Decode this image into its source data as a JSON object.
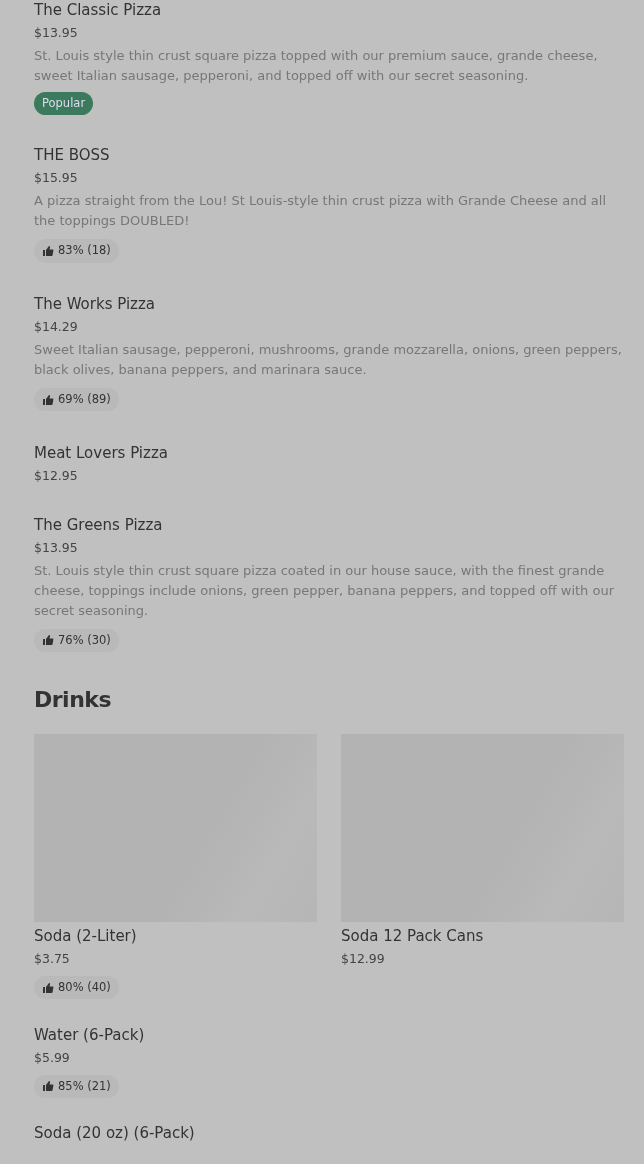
{
  "pizza_items": [
    {
      "name": "The Classic Pizza",
      "price": "$13.95",
      "description": "St. Louis style thin crust square pizza topped with our premium sauce, grande cheese, sweet Italian sausage, pepperoni, and topped off with our secret seasoning.",
      "badge": "Popular"
    },
    {
      "name": "THE BOSS",
      "price": "$15.95",
      "description": "A pizza straight from the Lou! St Louis-style thin crust pizza with Grande Cheese and all the toppings DOUBLED!",
      "rating": "83% (18)"
    },
    {
      "name": "The Works Pizza",
      "price": "$14.29",
      "description": "Sweet Italian sausage, pepperoni, mushrooms, grande mozzarella, onions, green peppers, black olives, banana peppers, and marinara sauce.",
      "rating": "69% (89)"
    },
    {
      "name": "Meat Lovers Pizza",
      "price": "$12.95"
    },
    {
      "name": "The Greens Pizza",
      "price": "$13.95",
      "description": "St. Louis style thin crust square pizza coated in our house sauce, with the finest grande cheese, toppings include onions, green pepper, banana peppers, and topped off with our secret seasoning.",
      "rating": "76% (30)"
    }
  ],
  "drinks": {
    "title": "Drinks",
    "items": [
      {
        "kind": "card",
        "name": "Soda (2-Liter)",
        "price": "$3.75",
        "rating": "80% (40)"
      },
      {
        "kind": "card",
        "name": "Soda 12 Pack Cans",
        "price": "$12.99"
      },
      {
        "kind": "row",
        "name": "Water (6-Pack)",
        "price": "$5.99",
        "rating": "85% (21)"
      },
      {
        "kind": "row",
        "name": "Soda (20 oz) (6-Pack)"
      }
    ]
  }
}
